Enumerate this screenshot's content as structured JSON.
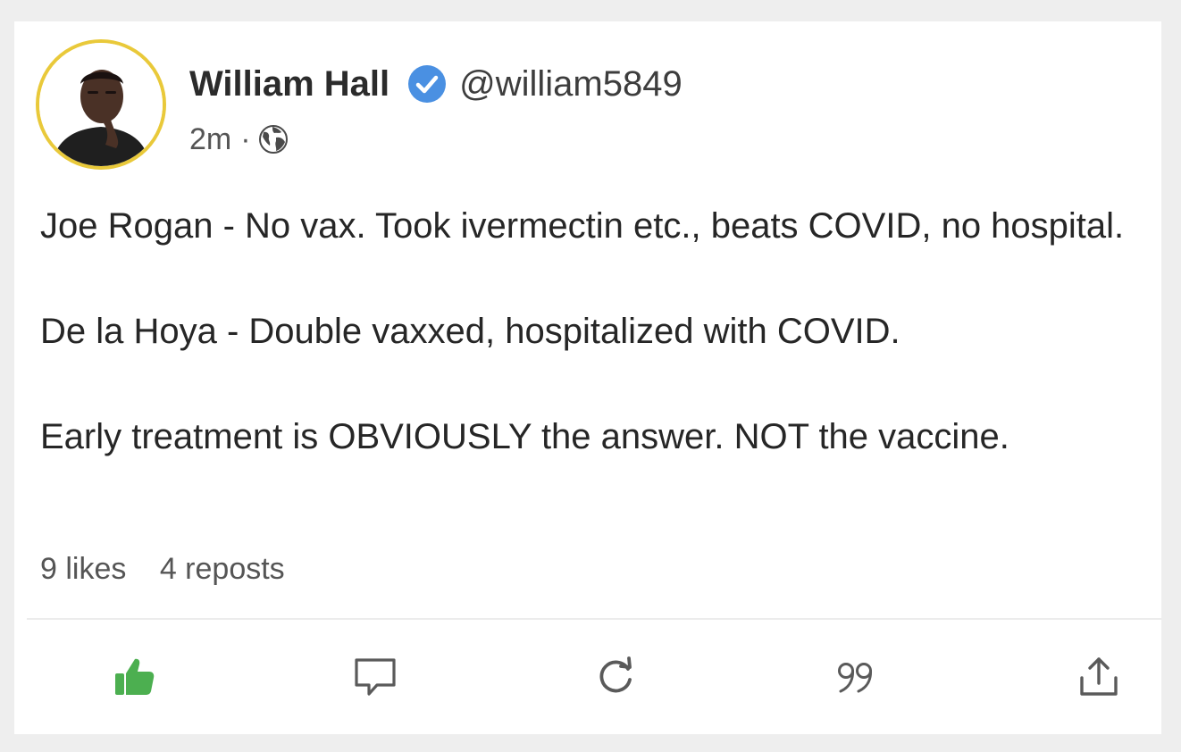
{
  "post": {
    "author": {
      "name": "William Hall",
      "handle": "@william5849",
      "verified_icon": "verified-badge-icon",
      "avatar_ring_color": "#e9c93a"
    },
    "time": "2m",
    "separator": "·",
    "visibility_icon": "globe-icon",
    "paragraphs": [
      "Joe Rogan - No vax. Took ivermectin etc., beats COVID, no hospital.",
      "De la Hoya - Double vaxxed, hospitalized with COVID.",
      "Early treatment is OBVIOUSLY the answer. NOT the vaccine."
    ],
    "stats": {
      "likes": "9 likes",
      "reposts": "4 reposts"
    }
  },
  "actions": [
    {
      "name": "like",
      "icon": "thumbs-up-icon",
      "active": true,
      "color": "#4caf50"
    },
    {
      "name": "comment",
      "icon": "comment-icon",
      "active": false,
      "color": "#5a5a5a"
    },
    {
      "name": "repost",
      "icon": "repost-icon",
      "active": false,
      "color": "#5a5a5a"
    },
    {
      "name": "quote",
      "icon": "quote-icon",
      "active": false,
      "color": "#5a5a5a"
    },
    {
      "name": "share",
      "icon": "share-icon",
      "active": false,
      "color": "#5a5a5a"
    }
  ],
  "colors": {
    "verified_badge": "#4a90e2",
    "like_active": "#4caf50"
  }
}
